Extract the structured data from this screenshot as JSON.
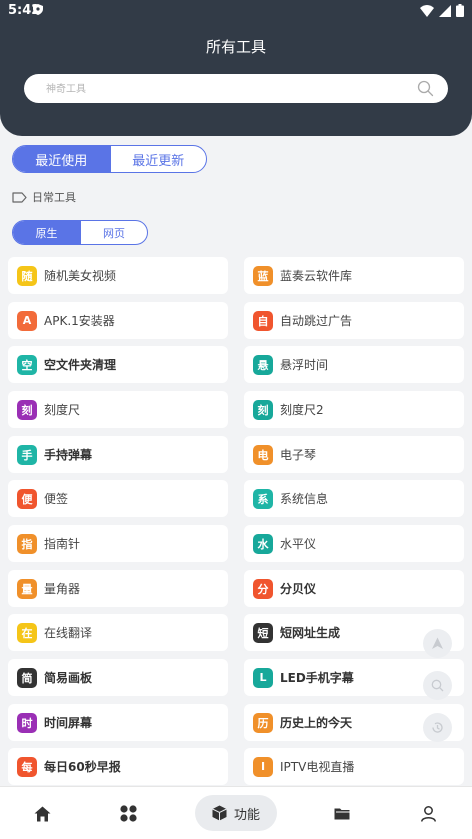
{
  "status": {
    "time": "5:42"
  },
  "header": {
    "title": "所有工具"
  },
  "search": {
    "placeholder": "神奇工具"
  },
  "segment_top": {
    "options": [
      "最近使用",
      "最近更新"
    ],
    "active": 0
  },
  "category": {
    "label": "日常工具"
  },
  "segment_sub": {
    "options": [
      "原生",
      "网页"
    ],
    "active": 0
  },
  "tools": [
    {
      "badge": "随",
      "label": "随机美女视频",
      "color": "#f5c518",
      "bold": false
    },
    {
      "badge": "蓝",
      "label": "蓝奏云软件库",
      "color": "#f0902a",
      "bold": false
    },
    {
      "badge": "A",
      "label": "APK.1安装器",
      "color": "#f26b3a",
      "bold": false
    },
    {
      "badge": "自",
      "label": "自动跳过广告",
      "color": "#f0552e",
      "bold": false
    },
    {
      "badge": "空",
      "label": "空文件夹清理",
      "color": "#1fb5a6",
      "bold": true
    },
    {
      "badge": "悬",
      "label": "悬浮时间",
      "color": "#17a89a",
      "bold": false
    },
    {
      "badge": "刻",
      "label": "刻度尺",
      "color": "#9a2fb5",
      "bold": false
    },
    {
      "badge": "刻",
      "label": "刻度尺2",
      "color": "#17a89a",
      "bold": false
    },
    {
      "badge": "手",
      "label": "手持弹幕",
      "color": "#1fb5a6",
      "bold": true
    },
    {
      "badge": "电",
      "label": "电子琴",
      "color": "#f0902a",
      "bold": false
    },
    {
      "badge": "便",
      "label": "便签",
      "color": "#f0552e",
      "bold": false
    },
    {
      "badge": "系",
      "label": "系统信息",
      "color": "#1fb5a6",
      "bold": false
    },
    {
      "badge": "指",
      "label": "指南针",
      "color": "#f0902a",
      "bold": false
    },
    {
      "badge": "水",
      "label": "水平仪",
      "color": "#17a89a",
      "bold": false
    },
    {
      "badge": "量",
      "label": "量角器",
      "color": "#f0902a",
      "bold": false
    },
    {
      "badge": "分",
      "label": "分贝仪",
      "color": "#f0552e",
      "bold": true
    },
    {
      "badge": "在",
      "label": "在线翻译",
      "color": "#f5c518",
      "bold": false
    },
    {
      "badge": "短",
      "label": "短网址生成",
      "color": "#333333",
      "bold": true
    },
    {
      "badge": "简",
      "label": "简易画板",
      "color": "#333333",
      "bold": true
    },
    {
      "badge": "L",
      "label": "LED手机字幕",
      "color": "#17a89a",
      "bold": true
    },
    {
      "badge": "时",
      "label": "时间屏幕",
      "color": "#9a2fb5",
      "bold": true
    },
    {
      "badge": "历",
      "label": "历史上的今天",
      "color": "#f0902a",
      "bold": true
    },
    {
      "badge": "每",
      "label": "每日60秒早报",
      "color": "#f0552e",
      "bold": true
    },
    {
      "badge": "I",
      "label": "IPTV电视直播",
      "color": "#f0902a",
      "bold": false
    }
  ],
  "bottom_nav": {
    "active_label": "功能"
  }
}
